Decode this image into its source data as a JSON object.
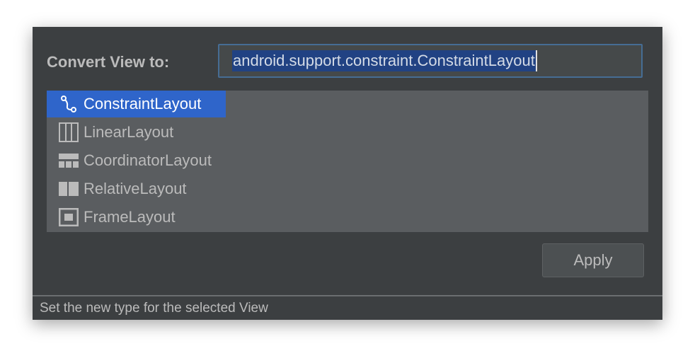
{
  "dialog": {
    "convert_label": "Convert View to:",
    "input_value": "android.support.constraint.ConstraintLayout",
    "apply_label": "Apply",
    "status_text": "Set the new type for the selected View"
  },
  "list": {
    "items": [
      {
        "label": "ConstraintLayout",
        "icon": "constraint-layout-icon",
        "selected": true
      },
      {
        "label": "LinearLayout",
        "icon": "linear-layout-icon",
        "selected": false
      },
      {
        "label": "CoordinatorLayout",
        "icon": "coordinator-layout-icon",
        "selected": false
      },
      {
        "label": "RelativeLayout",
        "icon": "relative-layout-icon",
        "selected": false
      },
      {
        "label": "FrameLayout",
        "icon": "frame-layout-icon",
        "selected": false
      }
    ]
  },
  "colors": {
    "dialog_bg": "#3c3f41",
    "list_bg": "#5a5d60",
    "selection": "#2f65ca",
    "text_selection": "#214283",
    "input_border": "#466d94"
  }
}
